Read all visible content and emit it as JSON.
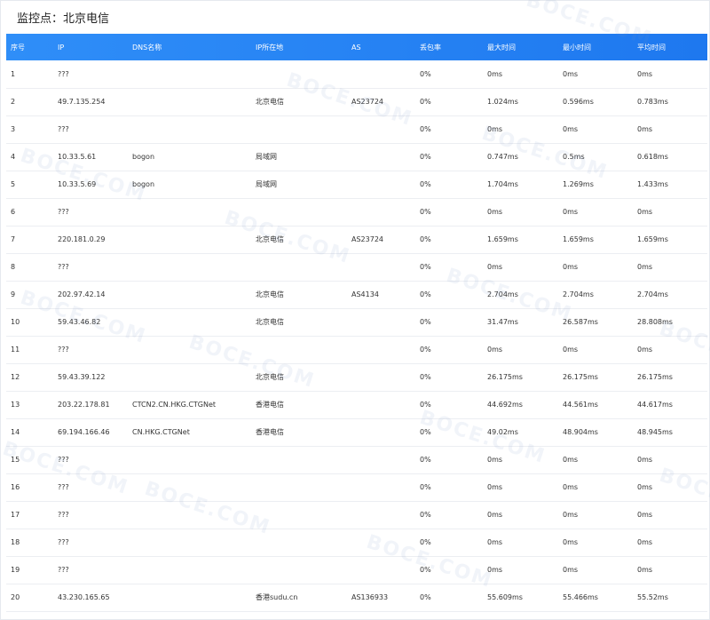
{
  "panel": {
    "title": "监控点：北京电信"
  },
  "watermark": "BOCE.COM",
  "table": {
    "columns": [
      "序号",
      "IP",
      "DNS名称",
      "IP所在地",
      "AS",
      "丢包率",
      "最大时间",
      "最小时间",
      "平均时间"
    ],
    "rows": [
      [
        "1",
        "???",
        "",
        "",
        "",
        "0%",
        "0ms",
        "0ms",
        "0ms"
      ],
      [
        "2",
        "49.7.135.254",
        "",
        "北京电信",
        "AS23724",
        "0%",
        "1.024ms",
        "0.596ms",
        "0.783ms"
      ],
      [
        "3",
        "???",
        "",
        "",
        "",
        "0%",
        "0ms",
        "0ms",
        "0ms"
      ],
      [
        "4",
        "10.33.5.61",
        "bogon",
        "局域网",
        "",
        "0%",
        "0.747ms",
        "0.5ms",
        "0.618ms"
      ],
      [
        "5",
        "10.33.5.69",
        "bogon",
        "局域网",
        "",
        "0%",
        "1.704ms",
        "1.269ms",
        "1.433ms"
      ],
      [
        "6",
        "???",
        "",
        "",
        "",
        "0%",
        "0ms",
        "0ms",
        "0ms"
      ],
      [
        "7",
        "220.181.0.29",
        "",
        "北京电信",
        "AS23724",
        "0%",
        "1.659ms",
        "1.659ms",
        "1.659ms"
      ],
      [
        "8",
        "???",
        "",
        "",
        "",
        "0%",
        "0ms",
        "0ms",
        "0ms"
      ],
      [
        "9",
        "202.97.42.14",
        "",
        "北京电信",
        "AS4134",
        "0%",
        "2.704ms",
        "2.704ms",
        "2.704ms"
      ],
      [
        "10",
        "59.43.46.82",
        "",
        "北京电信",
        "",
        "0%",
        "31.47ms",
        "26.587ms",
        "28.808ms"
      ],
      [
        "11",
        "???",
        "",
        "",
        "",
        "0%",
        "0ms",
        "0ms",
        "0ms"
      ],
      [
        "12",
        "59.43.39.122",
        "",
        "北京电信",
        "",
        "0%",
        "26.175ms",
        "26.175ms",
        "26.175ms"
      ],
      [
        "13",
        "203.22.178.81",
        "CTCN2.CN.HKG.CTGNet",
        "香港电信",
        "",
        "0%",
        "44.692ms",
        "44.561ms",
        "44.617ms"
      ],
      [
        "14",
        "69.194.166.46",
        "CN.HKG.CTGNet",
        "香港电信",
        "",
        "0%",
        "49.02ms",
        "48.904ms",
        "48.945ms"
      ],
      [
        "15",
        "???",
        "",
        "",
        "",
        "0%",
        "0ms",
        "0ms",
        "0ms"
      ],
      [
        "16",
        "???",
        "",
        "",
        "",
        "0%",
        "0ms",
        "0ms",
        "0ms"
      ],
      [
        "17",
        "???",
        "",
        "",
        "",
        "0%",
        "0ms",
        "0ms",
        "0ms"
      ],
      [
        "18",
        "???",
        "",
        "",
        "",
        "0%",
        "0ms",
        "0ms",
        "0ms"
      ],
      [
        "19",
        "???",
        "",
        "",
        "",
        "0%",
        "0ms",
        "0ms",
        "0ms"
      ],
      [
        "20",
        "43.230.165.65",
        "",
        "香港sudu.cn",
        "AS136933",
        "0%",
        "55.609ms",
        "55.466ms",
        "55.52ms"
      ]
    ]
  }
}
